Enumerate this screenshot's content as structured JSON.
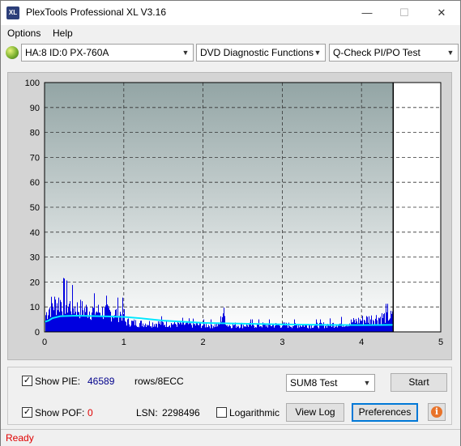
{
  "window": {
    "title": "PlexTools Professional XL V3.16",
    "icon_text": "XL",
    "min_glyph": "—",
    "max_glyph": "☐",
    "close_glyph": "✕"
  },
  "menu": {
    "options": "Options",
    "help": "Help"
  },
  "toolbar": {
    "drive": "HA:8 ID:0  PX-760A",
    "function": "DVD Diagnostic Functions",
    "test": "Q-Check PI/PO Test"
  },
  "chart_data": {
    "type": "bar",
    "xlim": [
      0,
      5
    ],
    "ylim": [
      0,
      100
    ],
    "x_ticks": [
      "0",
      "1",
      "2",
      "3",
      "4",
      "5"
    ],
    "y_ticks": [
      "0",
      "10",
      "20",
      "30",
      "40",
      "50",
      "60",
      "70",
      "80",
      "90",
      "100"
    ],
    "grid": true,
    "end_marker_x": 4.4,
    "pie_profile": [
      [
        0.0,
        9
      ],
      [
        0.05,
        14
      ],
      [
        0.1,
        16
      ],
      [
        0.2,
        18
      ],
      [
        0.3,
        16
      ],
      [
        0.4,
        14
      ],
      [
        0.5,
        13
      ],
      [
        0.7,
        12
      ],
      [
        0.9,
        11
      ],
      [
        1.0,
        11
      ],
      [
        1.01,
        6
      ],
      [
        1.2,
        5
      ],
      [
        1.5,
        5
      ],
      [
        2.0,
        4
      ],
      [
        2.2,
        4
      ],
      [
        2.25,
        12
      ],
      [
        2.3,
        4
      ],
      [
        3.0,
        4
      ],
      [
        3.5,
        4
      ],
      [
        3.8,
        5
      ],
      [
        4.0,
        7
      ],
      [
        4.3,
        9
      ],
      [
        4.4,
        9
      ]
    ],
    "sum8_line": [
      [
        0.0,
        4
      ],
      [
        0.05,
        4.5
      ],
      [
        0.1,
        5.5
      ],
      [
        0.2,
        6.3
      ],
      [
        0.4,
        6.5
      ],
      [
        0.8,
        6.2
      ],
      [
        1.0,
        6.0
      ],
      [
        1.2,
        5.5
      ],
      [
        1.5,
        4.5
      ],
      [
        2.0,
        3.6
      ],
      [
        2.5,
        3.3
      ],
      [
        3.0,
        3.0
      ],
      [
        3.5,
        2.8
      ],
      [
        4.0,
        2.7
      ],
      [
        4.4,
        2.8
      ]
    ],
    "colors": {
      "bars": "#0000e0",
      "line": "#00e8ff",
      "plot_top": "#93a5a5",
      "plot_bottom": "#ffffff",
      "marker": "#000000"
    }
  },
  "panel": {
    "show_pie_label": "Show PIE:",
    "show_pie_checked": true,
    "pie_value": "46589",
    "rows_label": "rows/8ECC",
    "show_pof_label": "Show POF:",
    "show_pof_checked": true,
    "pof_value": "0",
    "lsn_label": "LSN:",
    "lsn_value": "2298496",
    "logarithmic_label": "Logarithmic",
    "logarithmic_checked": false,
    "test_select": "SUM8 Test",
    "start_button": "Start",
    "view_log_button": "View Log",
    "preferences_button": "Preferences",
    "info_glyph": "i",
    "colors": {
      "pie_value": "#00008b",
      "pof_value": "#e00000"
    }
  },
  "status": {
    "text": "Ready"
  }
}
